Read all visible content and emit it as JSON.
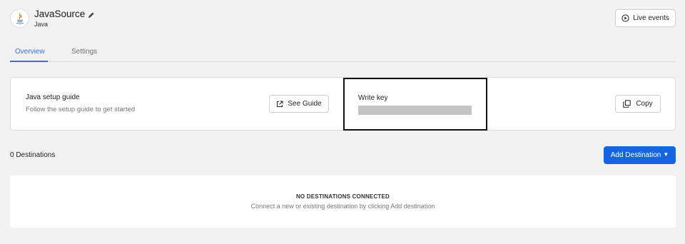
{
  "source": {
    "name": "JavaSource",
    "type": "Java",
    "icon": "java-logo-icon"
  },
  "header": {
    "live_events_label": "Live events",
    "live_events_icon": "play-circle-icon",
    "edit_icon": "pencil-icon"
  },
  "tabs": [
    {
      "label": "Overview",
      "active": true
    },
    {
      "label": "Settings",
      "active": false
    }
  ],
  "setup_card": {
    "title": "Java setup guide",
    "subtitle": "Follow the setup guide to get started",
    "see_guide_label": "See Guide",
    "see_guide_icon": "external-link-icon",
    "write_key_label": "Write key",
    "copy_label": "Copy",
    "copy_icon": "copy-icon"
  },
  "destinations": {
    "count_label": "0 Destinations",
    "add_label": "Add Destination",
    "empty_title": "NO DESTINATIONS CONNECTED",
    "empty_subtitle": "Connect a new or existing destination by clicking Add destination"
  },
  "colors": {
    "accent": "#1565e0",
    "tab_active": "#3b6fd1",
    "background": "#f2f2f2"
  }
}
